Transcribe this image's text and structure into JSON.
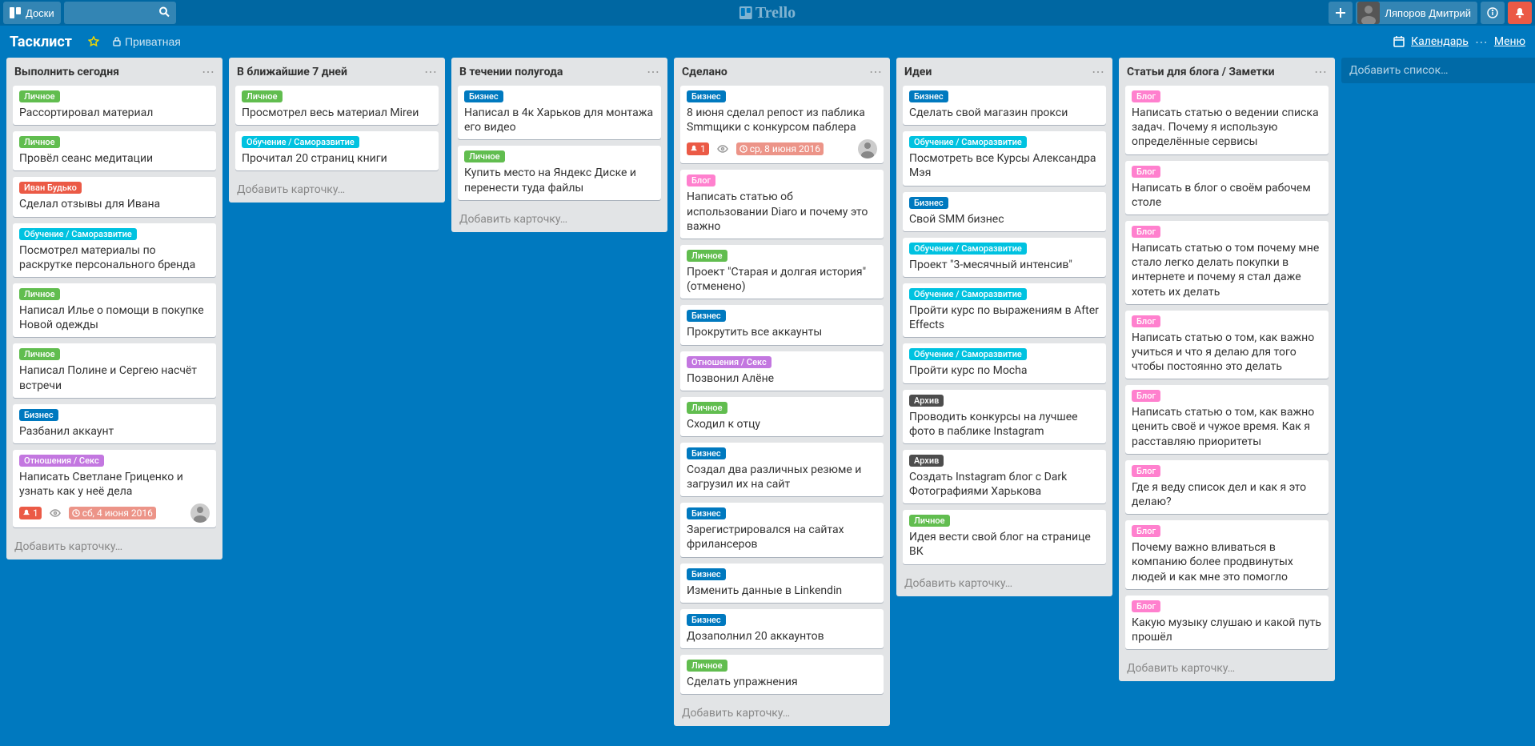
{
  "header": {
    "boards_label": "Доски",
    "username": "Ляпоров Дмитрий"
  },
  "board_header": {
    "name": "Тасклист",
    "privacy": "Приватная",
    "calendar": "Календарь",
    "menu": "Меню"
  },
  "labels": {
    "личное": {
      "text": "Личное",
      "color": "c-green"
    },
    "бизнес": {
      "text": "Бизнес",
      "color": "c-blue"
    },
    "иван": {
      "text": "Иван Будько",
      "color": "c-red"
    },
    "обучение": {
      "text": "Обучение / Саморазвитие",
      "color": "c-sky"
    },
    "отношения": {
      "text": "Отношения / Секс",
      "color": "c-purple"
    },
    "блог": {
      "text": "Блог",
      "color": "c-pink"
    },
    "архив": {
      "text": "Архив",
      "color": "c-black"
    }
  },
  "add_card": "Добавить карточку…",
  "add_list": "Добавить список…",
  "lists": [
    {
      "title": "Выполнить сегодня",
      "cards": [
        {
          "labels": [
            "личное"
          ],
          "text": "Рассортировал материал"
        },
        {
          "labels": [
            "личное"
          ],
          "text": "Провёл сеанс медитации"
        },
        {
          "labels": [
            "иван"
          ],
          "text": "Сделал отзывы для Ивана"
        },
        {
          "labels": [
            "обучение"
          ],
          "text": "Посмотрел материалы по раскрутке персонального бренда"
        },
        {
          "labels": [
            "личное"
          ],
          "text": "Написал Илье о помощи в покупке Новой одежды"
        },
        {
          "labels": [
            "личное"
          ],
          "text": "Написал Полине и Сергею насчёт встречи"
        },
        {
          "labels": [
            "бизнес"
          ],
          "text": "Разбанил аккаунт"
        },
        {
          "labels": [
            "отношения"
          ],
          "text": "Написать Светлане Гриценко и узнать как у неё дела",
          "badges": {
            "notif": "1",
            "watch": true,
            "due": "сб, 4 июня 2016",
            "avatar": true
          }
        }
      ]
    },
    {
      "title": "В ближайшие 7 дней",
      "cards": [
        {
          "labels": [
            "личное"
          ],
          "text": "Просмотрел весь материал Mirеи"
        },
        {
          "labels": [
            "обучение"
          ],
          "text": "Прочитал 20 страниц книги"
        }
      ]
    },
    {
      "title": "В течении полугода",
      "cards": [
        {
          "labels": [
            "бизнес"
          ],
          "text": "Написал в 4к Харьков для монтажа его видео"
        },
        {
          "labels": [
            "личное"
          ],
          "text": "Купить место на Яндекс Диске и перенести туда файлы"
        }
      ]
    },
    {
      "title": "Сделано",
      "cards": [
        {
          "labels": [
            "бизнес"
          ],
          "text": "8 июня сделал репост из паблика Smmщики с конкурсом паблера",
          "badges": {
            "notif": "1",
            "watch": true,
            "due": "ср, 8 июня 2016",
            "avatar": true
          }
        },
        {
          "labels": [
            "блог"
          ],
          "text": "Написать статью об использовании Diaro и почему это важно"
        },
        {
          "labels": [
            "личное"
          ],
          "text": "Проект \"Старая и долгая история\" (отменено)"
        },
        {
          "labels": [
            "бизнес"
          ],
          "text": "Прокрутить все аккаунты"
        },
        {
          "labels": [
            "отношения"
          ],
          "text": "Позвонил Алёне"
        },
        {
          "labels": [
            "личное"
          ],
          "text": "Сходил к отцу"
        },
        {
          "labels": [
            "бизнес"
          ],
          "text": "Создал два различных резюме и загрузил их на сайт"
        },
        {
          "labels": [
            "бизнес"
          ],
          "text": "Зарегистрировался на сайтах фрилансеров"
        },
        {
          "labels": [
            "бизнес"
          ],
          "text": "Изменить данные в Linkendin"
        },
        {
          "labels": [
            "бизнес"
          ],
          "text": "Дозаполнил 20 аккаунтов"
        },
        {
          "labels": [
            "личное"
          ],
          "text": "Сделать упражнения"
        }
      ]
    },
    {
      "title": "Идеи",
      "cards": [
        {
          "labels": [
            "бизнес"
          ],
          "text": "Сделать свой магазин прокси"
        },
        {
          "labels": [
            "обучение"
          ],
          "text": "Посмотреть все Курсы Александра Мэя"
        },
        {
          "labels": [
            "бизнес"
          ],
          "text": "Свой SMM бизнес"
        },
        {
          "labels": [
            "обучение"
          ],
          "text": "Проект \"3-месячный интенсив\""
        },
        {
          "labels": [
            "обучение"
          ],
          "text": "Пройти курс по выражениям в After Effects"
        },
        {
          "labels": [
            "обучение"
          ],
          "text": "Пройти курс по Mocha"
        },
        {
          "labels": [
            "архив"
          ],
          "text": "Проводить конкурсы на лучшее фото в паблике Instagram"
        },
        {
          "labels": [
            "архив"
          ],
          "text": "Создать Instagram блог с Dark Фотографиями Харькова"
        },
        {
          "labels": [
            "личное"
          ],
          "text": "Идея вести свой блог на странице ВК"
        }
      ]
    },
    {
      "title": "Статьи для блога / Заметки",
      "cards": [
        {
          "labels": [
            "блог"
          ],
          "text": "Написать статью о ведении списка задач. Почему я использую определённые сервисы"
        },
        {
          "labels": [
            "блог"
          ],
          "text": "Написать в блог о своём рабочем столе"
        },
        {
          "labels": [
            "блог"
          ],
          "text": "Написать статью о том почему мне стало легко делать покупки в интернете и почему я стал даже хотеть их делать"
        },
        {
          "labels": [
            "блог"
          ],
          "text": "Написать статью о том, как важно учиться и что я делаю для того чтобы постоянно это делать"
        },
        {
          "labels": [
            "блог"
          ],
          "text": "Написать статью о том, как важно ценить своё и чужое время. Как я расставляю приоритеты"
        },
        {
          "labels": [
            "блог"
          ],
          "text": "Где я веду список дел и как я это делаю?"
        },
        {
          "labels": [
            "блог"
          ],
          "text": "Почему важно вливаться в компанию более продвинутых людей и как мне это помогло"
        },
        {
          "labels": [
            "блог"
          ],
          "text": "Какую музыку слушаю и какой путь прошёл"
        }
      ]
    }
  ]
}
